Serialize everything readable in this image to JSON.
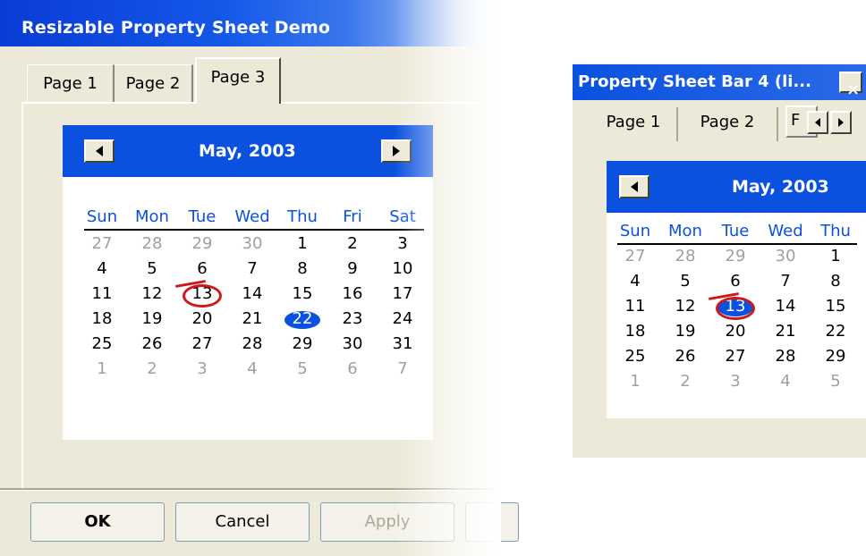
{
  "dialog": {
    "title": "Resizable Property Sheet Demo",
    "tabs": [
      "Page 1",
      "Page 2",
      "Page 3"
    ],
    "active_tab": "Page 3",
    "buttons": {
      "ok": "OK",
      "cancel": "Cancel",
      "apply": "Apply"
    }
  },
  "calendar": {
    "month_label": "May, 2003",
    "weekdays": [
      "Sun",
      "Mon",
      "Tue",
      "Wed",
      "Thu",
      "Fri",
      "Sat"
    ],
    "weeks": [
      [
        "27",
        "28",
        "29",
        "30",
        "1",
        "2",
        "3"
      ],
      [
        "4",
        "5",
        "6",
        "7",
        "8",
        "9",
        "10"
      ],
      [
        "11",
        "12",
        "13",
        "14",
        "15",
        "16",
        "17"
      ],
      [
        "18",
        "19",
        "20",
        "21",
        "22",
        "23",
        "24"
      ],
      [
        "25",
        "26",
        "27",
        "28",
        "29",
        "30",
        "31"
      ],
      [
        "1",
        "2",
        "3",
        "4",
        "5",
        "6",
        "7"
      ]
    ],
    "today": "13",
    "selected": "22"
  },
  "bar": {
    "title": "Property Sheet Bar 4 (li...",
    "close": "×",
    "tabs": [
      "Page 1",
      "Page 2",
      "F"
    ],
    "calendar": {
      "month_label": "May, 2003",
      "weekdays": [
        "Sun",
        "Mon",
        "Tue",
        "Wed",
        "Thu"
      ],
      "weeks": [
        [
          "27",
          "28",
          "29",
          "30",
          "1"
        ],
        [
          "4",
          "5",
          "6",
          "7",
          "8"
        ],
        [
          "11",
          "12",
          "13",
          "14",
          "15"
        ],
        [
          "18",
          "19",
          "20",
          "21",
          "22"
        ],
        [
          "25",
          "26",
          "27",
          "28",
          "29"
        ],
        [
          "1",
          "2",
          "3",
          "4",
          "5"
        ]
      ],
      "today": "13",
      "selected": "13"
    }
  },
  "colors": {
    "title_blue": "#0a51e0",
    "face": "#ece9d8",
    "today_ring": "#d01818",
    "muted_day": "#a0a0a0"
  }
}
